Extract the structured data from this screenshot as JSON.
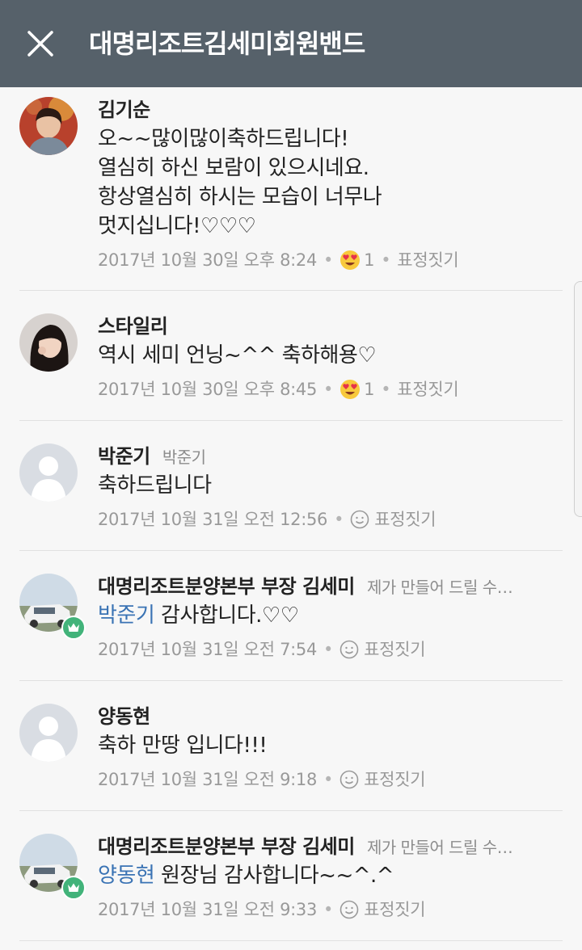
{
  "header": {
    "title": "대명리조트김세미회원밴드",
    "close_icon": "close-icon",
    "background": "#56616a"
  },
  "comments": [
    {
      "author": "김기순",
      "author_sub": "",
      "mention": "",
      "lines": [
        "오~~많이많이축하드립니다!",
        "열심히 하신 보람이 있으시네요.",
        "항상열심히 하시는 모습이 너무나",
        "멋지십니다!♡♡♡"
      ],
      "timestamp": "2017년 10월 30일 오후 8:24",
      "reaction_icon": "heart-eyes-emoji-icon",
      "reaction_count": "1",
      "react_label": "표정짓기"
    },
    {
      "author": "스타일리",
      "author_sub": "",
      "mention": "",
      "lines": [
        "역시 세미 언닝~^^ 축하해용♡"
      ],
      "timestamp": "2017년 10월 30일 오후 8:45",
      "reaction_icon": "heart-eyes-emoji-icon",
      "reaction_count": "1",
      "react_label": "표정짓기"
    },
    {
      "author": "박준기",
      "author_sub": "박준기",
      "mention": "",
      "lines": [
        "축하드립니다"
      ],
      "timestamp": "2017년 10월 31일 오전 12:56",
      "reaction_icon": "smiley-outline-icon",
      "reaction_count": "",
      "react_label": "표정짓기"
    },
    {
      "author": "대명리조트분양본부 부장 김세미",
      "author_sub": "제가 만들어 드릴 수…",
      "mention": "박준기",
      "lines": [
        "감사합니다.♡♡"
      ],
      "timestamp": "2017년 10월 31일 오전 7:54",
      "reaction_icon": "smiley-outline-icon",
      "reaction_count": "",
      "react_label": "표정짓기"
    },
    {
      "author": "양동현",
      "author_sub": "",
      "mention": "",
      "lines": [
        "축하 만땅 입니다!!!"
      ],
      "timestamp": "2017년 10월 31일 오전 9:18",
      "reaction_icon": "smiley-outline-icon",
      "reaction_count": "",
      "react_label": "표정짓기"
    },
    {
      "author": "대명리조트분양본부 부장 김세미",
      "author_sub": "제가 만들어 드릴 수…",
      "mention": "양동현",
      "lines": [
        "원장님 감사합니다~~^.^"
      ],
      "timestamp": "2017년 10월 31일 오전 9:33",
      "reaction_icon": "smiley-outline-icon",
      "reaction_count": "",
      "react_label": "표정짓기"
    }
  ],
  "colors": {
    "mention": "#3a73b4",
    "crown_badge": "#42b37a",
    "meta_text": "#999999"
  }
}
